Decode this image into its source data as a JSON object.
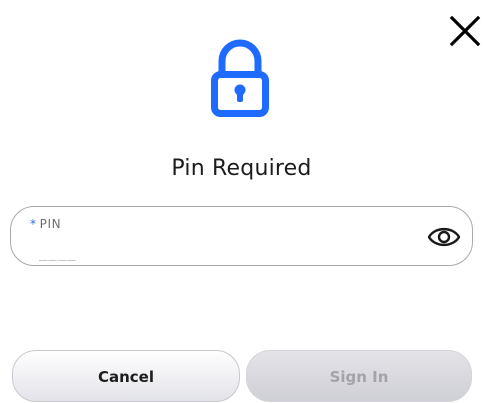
{
  "dialog": {
    "close_icon": "close-icon",
    "lock_icon": "lock-icon",
    "title": "Pin Required"
  },
  "pin_field": {
    "required_marker": "*",
    "label": "PIN",
    "value": "",
    "placeholder": "____",
    "toggle_icon": "eye-icon"
  },
  "actions": {
    "cancel_label": "Cancel",
    "sign_in_label": "Sign In",
    "sign_in_enabled": false
  },
  "colors": {
    "accent": "#2b6fe0",
    "lock_blue": "#1f6bff",
    "text": "#1c1c1c"
  }
}
